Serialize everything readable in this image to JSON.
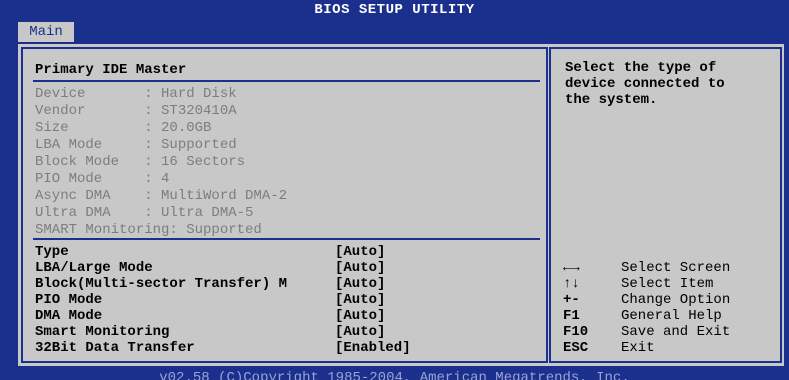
{
  "window": {
    "title": "BIOS SETUP UTILITY",
    "tab": "Main",
    "footer": "v02.58 (C)Copyright 1985-2004, American Megatrends, Inc."
  },
  "section_title": "Primary IDE Master",
  "device_info": [
    "Device       : Hard Disk",
    "Vendor       : ST320410A",
    "Size         : 20.0GB",
    "LBA Mode     : Supported",
    "Block Mode   : 16 Sectors",
    "PIO Mode     : 4",
    "Async DMA    : MultiWord DMA-2",
    "Ultra DMA    : Ultra DMA-5",
    "SMART Monitoring: Supported"
  ],
  "settings": [
    {
      "label": "Type",
      "value": "[Auto]"
    },
    {
      "label": "LBA/Large Mode",
      "value": "[Auto]"
    },
    {
      "label": "Block(Multi-sector Transfer) M",
      "value": "[Auto]"
    },
    {
      "label": "PIO Mode",
      "value": "[Auto]"
    },
    {
      "label": "DMA Mode",
      "value": "[Auto]"
    },
    {
      "label": "Smart Monitoring",
      "value": "[Auto]"
    },
    {
      "label": "32Bit Data Transfer",
      "value": "[Enabled]"
    }
  ],
  "help": {
    "text": "Select the type of\ndevice connected to\nthe system."
  },
  "navigation": [
    {
      "key": "←→",
      "desc": "Select Screen"
    },
    {
      "key": "↑↓",
      "desc": "Select Item"
    },
    {
      "key": "+-",
      "desc": "Change Option"
    },
    {
      "key": "F1",
      "desc": "General Help"
    },
    {
      "key": "F10",
      "desc": "Save and Exit"
    },
    {
      "key": "ESC",
      "desc": "Exit"
    }
  ],
  "colors": {
    "background_blue": "#1b2f8c",
    "panel_gray": "#c8c8c8",
    "disabled_text": "#7d7d7d"
  }
}
